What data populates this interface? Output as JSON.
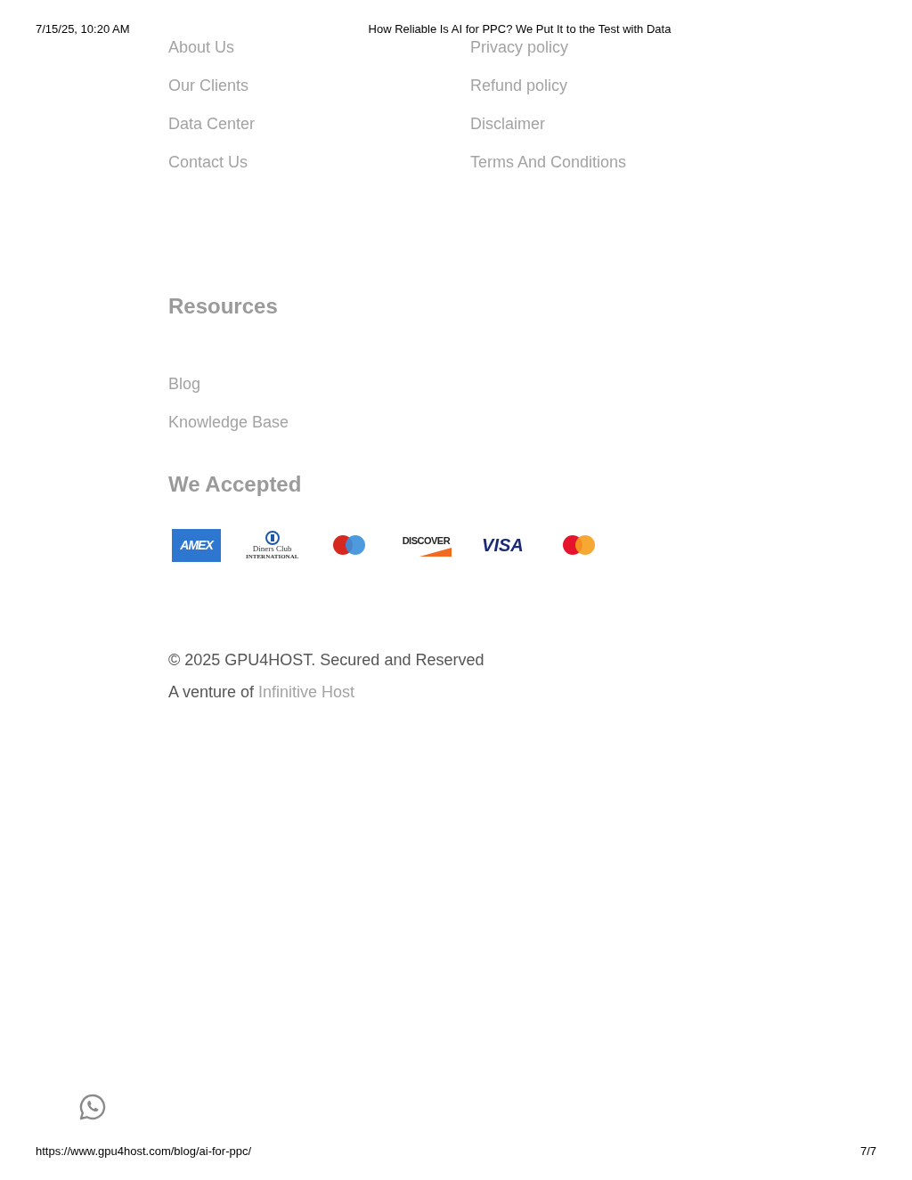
{
  "print_header": {
    "date": "7/15/25, 10:20 AM",
    "title": "How Reliable Is AI for PPC? We Put It to the Test with Data"
  },
  "company_links": [
    {
      "label": "About Us"
    },
    {
      "label": "Our Clients"
    },
    {
      "label": "Data Center"
    },
    {
      "label": "Contact Us"
    }
  ],
  "policy_links": [
    {
      "label": "Privacy policy"
    },
    {
      "label": "Refund policy"
    },
    {
      "label": "Disclaimer"
    },
    {
      "label": "Terms And Conditions"
    }
  ],
  "resources": {
    "heading": "Resources",
    "links": [
      {
        "label": "Blog"
      },
      {
        "label": "Knowledge Base"
      }
    ]
  },
  "payments": {
    "heading": "We Accepted",
    "logos": [
      {
        "kind": "amex",
        "text": "AMEX"
      },
      {
        "kind": "diners",
        "text": "Diners Club",
        "subtext": "INTERNATIONAL"
      },
      {
        "kind": "maestro"
      },
      {
        "kind": "discover",
        "text": "DISCOVER"
      },
      {
        "kind": "visa",
        "text": "VISA"
      },
      {
        "kind": "mastercard"
      }
    ]
  },
  "copyright": "© 2025 GPU4HOST. Secured and Reserved",
  "venture": {
    "text": "A venture of",
    "link": "Infinitive Host"
  },
  "print_footer": {
    "url": "https://www.gpu4host.com/blog/ai-for-ppc/",
    "page": "7/7"
  }
}
